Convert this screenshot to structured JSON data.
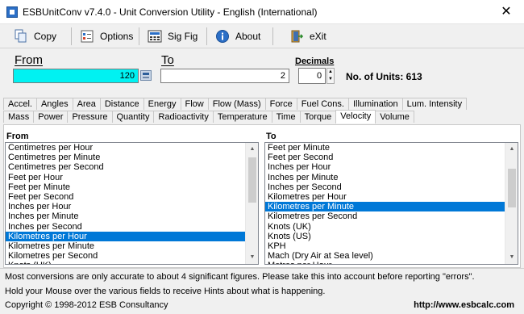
{
  "window": {
    "title": "ESBUnitConv v7.4.0 - Unit Conversion Utility - English (International)",
    "close": "✕"
  },
  "toolbar": [
    {
      "key": "copy",
      "label": "Copy",
      "icon": "copy-icon"
    },
    {
      "key": "options",
      "label": "Options",
      "icon": "options-icon"
    },
    {
      "key": "sigfig",
      "label": "Sig Fig",
      "icon": "sigfig-icon"
    },
    {
      "key": "about",
      "label": "About",
      "icon": "info-icon"
    },
    {
      "key": "exit",
      "label": "eXit",
      "icon": "exit-icon"
    }
  ],
  "conversion": {
    "from_label": "From",
    "to_label": "To",
    "from_value": "120",
    "to_value": "2",
    "decimals_label": "Decimals",
    "decimals_value": "0",
    "units_label": "No. of Units: 613"
  },
  "colors": {
    "from_field": "#00f2f2",
    "selection": "#0078d7"
  },
  "tabs": {
    "row1": [
      "Accel.",
      "Angles",
      "Area",
      "Distance",
      "Energy",
      "Flow",
      "Flow (Mass)",
      "Force",
      "Fuel Cons.",
      "Illumination",
      "Lum. Intensity"
    ],
    "row2": [
      "Mass",
      "Power",
      "Pressure",
      "Quantity",
      "Radioactivity",
      "Temperature",
      "Time",
      "Torque",
      "Velocity",
      "Volume"
    ],
    "active": "Velocity"
  },
  "from_list": {
    "label": "From",
    "items": [
      "Centimetres per Hour",
      "Centimetres per Minute",
      "Centimetres per Second",
      "Feet per Hour",
      "Feet per Minute",
      "Feet per Second",
      "Inches per Hour",
      "Inches per Minute",
      "Inches per Second",
      "Kilometres per Hour",
      "Kilometres per Minute",
      "Kilometres per Second",
      "Knots (UK)"
    ],
    "selected": "Kilometres per Hour"
  },
  "to_list": {
    "label": "To",
    "items": [
      "Feet per Minute",
      "Feet per Second",
      "Inches per Hour",
      "Inches per Minute",
      "Inches per Second",
      "Kilometres per Hour",
      "Kilometres per Minute",
      "Kilometres per Second",
      "Knots (UK)",
      "Knots (US)",
      "KPH",
      "Mach (Dry Air at Sea level)",
      "Metres per Hour"
    ],
    "selected": "Kilometres per Minute"
  },
  "status": {
    "line1": "Most conversions are only accurate to about 4 significant figures. Please take this into account before reporting \"errors\".",
    "line2": "Hold your Mouse over the various fields to receive Hints about what is happening.",
    "copyright": "Copyright © 1998-2012 ESB Consultancy",
    "url": "http://www.esbcalc.com"
  }
}
